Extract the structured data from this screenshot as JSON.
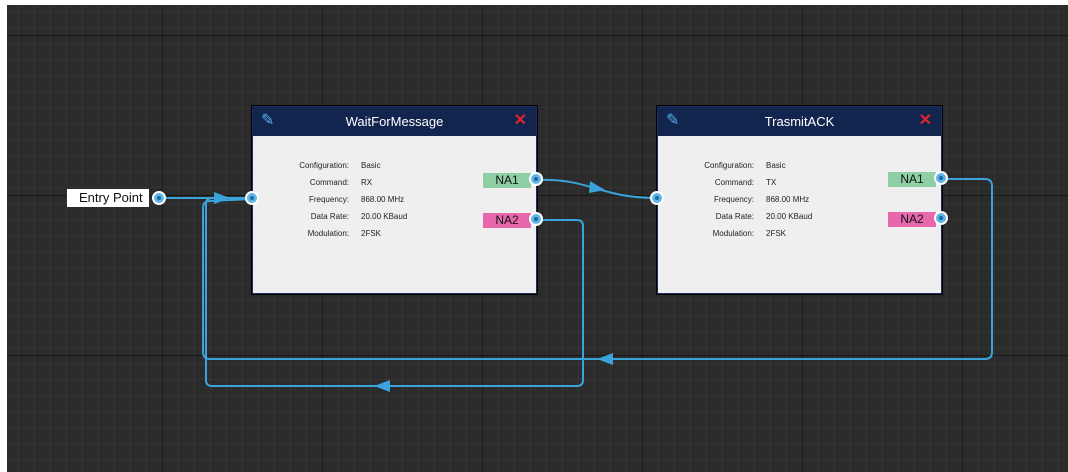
{
  "entry_point": {
    "label": "Entry Point"
  },
  "nodes": [
    {
      "title": "WaitForMessage",
      "properties": [
        {
          "label": "Configuration:",
          "value": "Basic"
        },
        {
          "label": "Command:",
          "value": "RX"
        },
        {
          "label": "Frequency:",
          "value": "868.00 MHz"
        },
        {
          "label": "Data Rate:",
          "value": "20.00 KBaud"
        },
        {
          "label": "Modulation:",
          "value": "2FSK"
        }
      ],
      "outputs": [
        {
          "label": "NA1"
        },
        {
          "label": "NA2"
        }
      ]
    },
    {
      "title": "TrasmitACK",
      "properties": [
        {
          "label": "Configuration:",
          "value": "Basic"
        },
        {
          "label": "Command:",
          "value": "TX"
        },
        {
          "label": "Frequency:",
          "value": "868.00 MHz"
        },
        {
          "label": "Data Rate:",
          "value": "20.00 KBaud"
        },
        {
          "label": "Modulation:",
          "value": "2FSK"
        }
      ],
      "outputs": [
        {
          "label": "NA1"
        },
        {
          "label": "NA2"
        }
      ]
    }
  ],
  "icons": {
    "edit": "pencil-icon",
    "close": "close-icon"
  },
  "colors": {
    "canvas": "#2b2b2b",
    "header": "#12254f",
    "wire": "#3aa3dc",
    "output_na1": "#8ecfa5",
    "output_na2": "#e867ad",
    "close": "#e0242c"
  }
}
